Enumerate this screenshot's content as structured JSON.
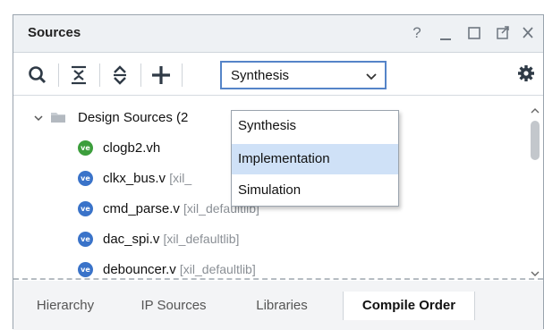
{
  "panel": {
    "title": "Sources",
    "help_label": "?"
  },
  "toolbar": {
    "icons": [
      "search-icon",
      "collapse-all-icon",
      "expand-all-icon",
      "add-icon",
      "gear-icon"
    ],
    "select_value": "Synthesis"
  },
  "tree": {
    "root": {
      "label": "Design Sources (2"
    },
    "items": [
      {
        "name": "clogb2.vh",
        "lib": "",
        "icon": "verilog-header-icon"
      },
      {
        "name": "clkx_bus.v",
        "lib": "[xil_",
        "icon": "verilog-icon"
      },
      {
        "name": "cmd_parse.v",
        "lib": "[xil_defaultlib]",
        "icon": "verilog-icon"
      },
      {
        "name": "dac_spi.v",
        "lib": "[xil_defaultlib]",
        "icon": "verilog-icon"
      },
      {
        "name": "debouncer.v",
        "lib": "[xil_defaultlib]",
        "icon": "verilog-icon"
      }
    ]
  },
  "dropdown": {
    "options": [
      "Synthesis",
      "Implementation",
      "Simulation"
    ],
    "highlighted": "Implementation"
  },
  "tabs": [
    {
      "label": "Hierarchy",
      "active": false
    },
    {
      "label": "IP Sources",
      "active": false
    },
    {
      "label": "Libraries",
      "active": false
    },
    {
      "label": "Compile Order",
      "active": true
    }
  ],
  "colors": {
    "header_bg": "#eef1f4",
    "accent": "#5584c8",
    "highlight": "#cfe1f7",
    "verilog_icon": "#3a73c9",
    "header_icon": "#3c9e3c"
  }
}
